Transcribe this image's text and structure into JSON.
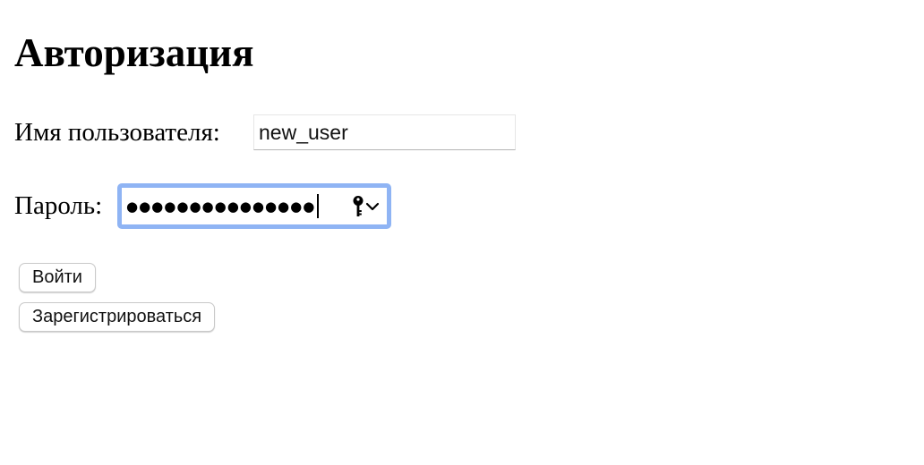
{
  "page": {
    "title": "Авторизация"
  },
  "form": {
    "username_label": "Имя пользователя:",
    "username_value": "new_user",
    "password_label": "Пароль:",
    "password_masked": "●●●●●●●●●●●●●●●",
    "password_focused": true,
    "focus_ring_color": "#8fb4f4"
  },
  "icons": {
    "password_key": "key-icon",
    "password_dropdown": "chevron-down-icon"
  },
  "buttons": {
    "login_label": "Войти",
    "register_label": "Зарегистрироваться"
  }
}
